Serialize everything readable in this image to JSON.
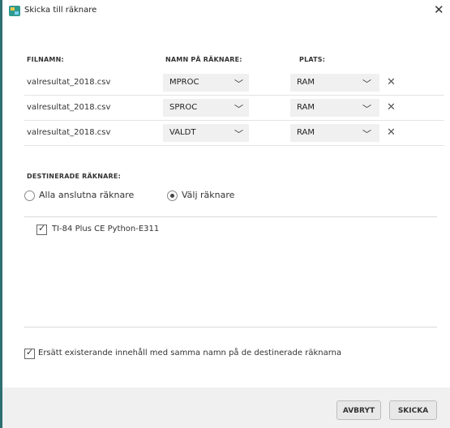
{
  "window": {
    "title": "Skicka till räknare"
  },
  "columns": {
    "filename": "FILNAMN:",
    "calculator_name": "NAMN PÅ RÄKNARE:",
    "location": "PLATS:"
  },
  "files": [
    {
      "filename": "valresultat_2018.csv",
      "calculator_name": "MPROC",
      "location": "RAM"
    },
    {
      "filename": "valresultat_2018.csv",
      "calculator_name": "SPROC",
      "location": "RAM"
    },
    {
      "filename": "valresultat_2018.csv",
      "calculator_name": "VALDT",
      "location": "RAM"
    }
  ],
  "destination": {
    "label": "DESTINERADE RÄKNARE:",
    "options": [
      "Alla anslutna räknare",
      "Välj räknare"
    ],
    "selected": "Välj räknare",
    "calculators": [
      {
        "name": "TI-84 Plus CE Python-E311",
        "checked": true
      }
    ]
  },
  "replace_option": {
    "label": "Ersätt existerande innehåll med samma namn på de destinerade räknarna",
    "checked": true
  },
  "buttons": {
    "cancel": "AVBRYT",
    "send": "SKICKA"
  },
  "icons": {
    "app": "ti-connect-icon",
    "close": "close-icon",
    "dropdown": "chevron-down-icon",
    "remove": "remove-x-icon",
    "check": "check-icon"
  }
}
